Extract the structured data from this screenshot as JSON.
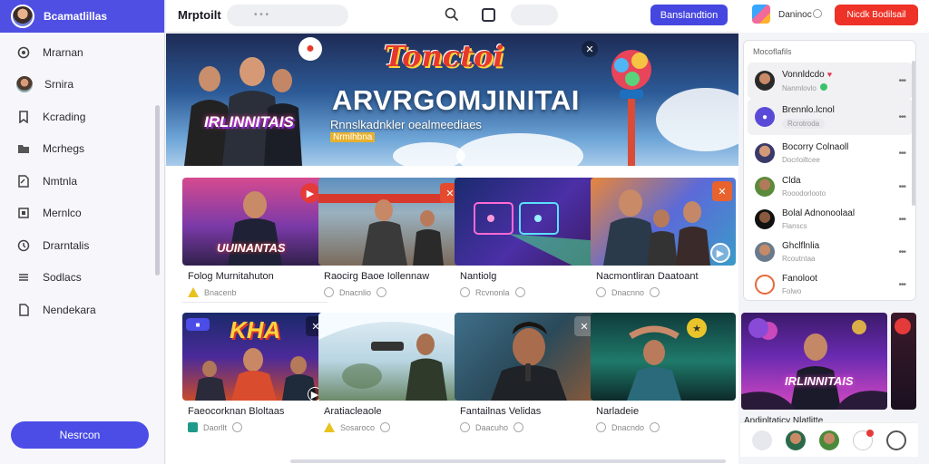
{
  "sidebar": {
    "header_title": "Bcamatlillas",
    "items": [
      {
        "label": "Mrarnan",
        "icon": "target-icon"
      },
      {
        "label": "Srnira",
        "icon": "user-photo-icon"
      },
      {
        "label": "Kcrading",
        "icon": "bookmark-icon"
      },
      {
        "label": "Mcrhegs",
        "icon": "folder-icon"
      },
      {
        "label": "Nmtnla",
        "icon": "edit-icon"
      },
      {
        "label": "Mernlco",
        "icon": "box-icon"
      },
      {
        "label": "Drarntalis",
        "icon": "clock-icon"
      },
      {
        "label": "Sodlacs",
        "icon": "list-icon"
      },
      {
        "label": "Nendekara",
        "icon": "document-icon"
      }
    ],
    "bottom_button": "Nesrcon"
  },
  "topbar": {
    "brand": "Mrptoilt",
    "search_placeholder": "• • •",
    "primary_button": "Banslandtion"
  },
  "right_header": {
    "label": "Daninoc",
    "cta": "Nicdk Bodilsail"
  },
  "hero": {
    "logo_text": "Tonctoi",
    "title": "ARVRGOMJINITAI",
    "subtitle": "Rnnslkadnkler oealmeediaes",
    "tag": "Nrmlhbna",
    "badge_text": "IRLINNITAIS"
  },
  "cards": [
    {
      "title": "Folog Murnitahuton",
      "meta": "Bnacenb",
      "meta_icon": "warning-icon",
      "thumb_text": "UUINANTAS"
    },
    {
      "title": "Raocirg Baoe Iollennaw",
      "meta": "Dnacnlio",
      "meta_icon": "info-icon",
      "thumb_text": ""
    },
    {
      "title": "Nantiolg",
      "meta": "Rcvnonla",
      "meta_icon": "info-icon",
      "thumb_text": ""
    },
    {
      "title": "Nacmontliran Daatoant",
      "meta": "Dnacnno",
      "meta_icon": "info-icon",
      "thumb_text": ""
    },
    {
      "title": "Faeocorknan Bloltaas",
      "meta": "Daorllt",
      "meta_icon": "tag-icon",
      "thumb_text": "KHA"
    },
    {
      "title": "Aratiacleaole",
      "meta": "Sosaroco",
      "meta_icon": "warning-icon",
      "thumb_text": ""
    },
    {
      "title": "Fantailnas Velidas",
      "meta": "Daacuho",
      "meta_icon": "info-icon",
      "thumb_text": ""
    },
    {
      "title": "Narladeie",
      "meta": "Dnacndo",
      "meta_icon": "info-icon",
      "thumb_text": ""
    }
  ],
  "right_panel": {
    "title": "Mocoflafils",
    "rows": [
      {
        "name": "Vonnldcdo",
        "sub": "Nanmlovlo",
        "extra": "heart",
        "dots": "•••"
      },
      {
        "name": "Brennlo.lcnol",
        "sub": "Rcrotroda",
        "extra": "chip",
        "dots": "•••"
      },
      {
        "name": "Bocorry Colnaoll",
        "sub": "Docrloiltcee",
        "extra": "",
        "dots": "•••"
      },
      {
        "name": "Clda",
        "sub": "Rooodorlooto",
        "extra": "",
        "dots": "•••"
      },
      {
        "name": "Bolal Adnonoolaal",
        "sub": "Flanscs",
        "extra": "",
        "dots": "•••"
      },
      {
        "name": "Ghclflnlia",
        "sub": "Rcoutntaa",
        "extra": "",
        "dots": "•••"
      },
      {
        "name": "Fanoloot",
        "sub": "Folwo",
        "extra": "",
        "dots": "•••"
      }
    ]
  },
  "live_card": {
    "thumb_text": "IRLINNITAIS",
    "caption": "Andinltaticy Nlatlitte"
  },
  "colors": {
    "accent": "#4f4fe3",
    "cta_red": "#ee3227"
  }
}
